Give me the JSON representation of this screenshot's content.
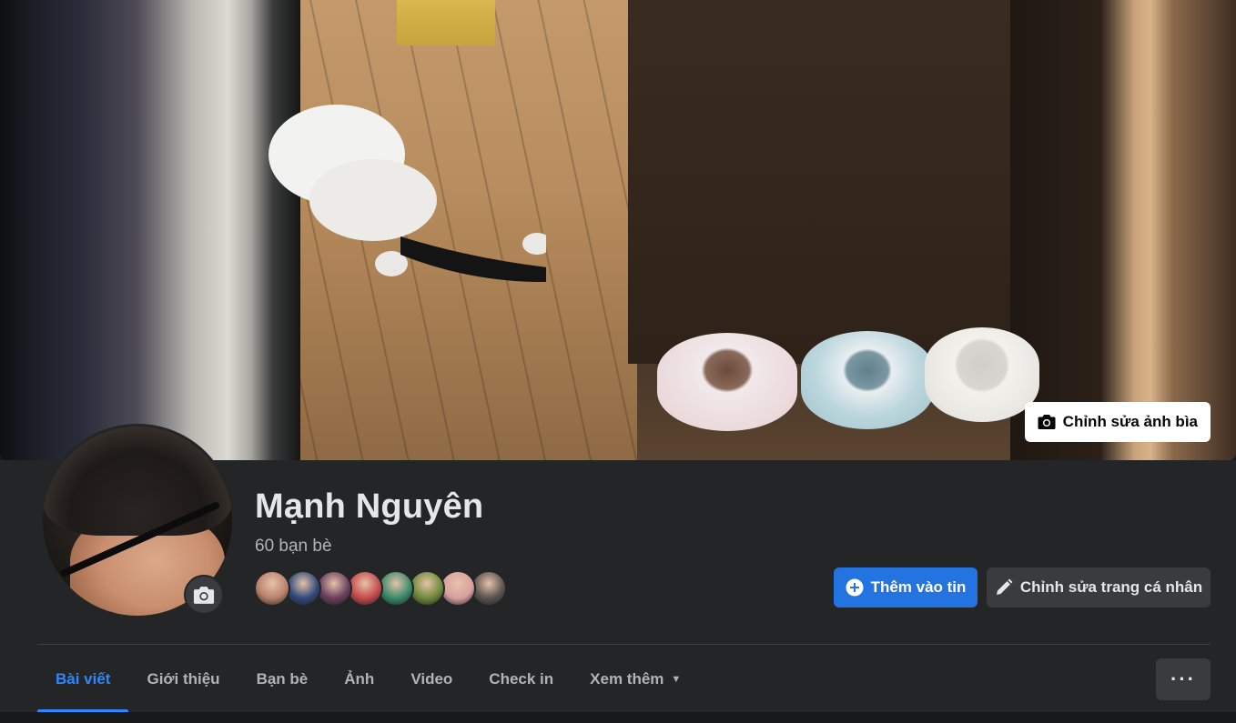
{
  "cover": {
    "edit_button_label": "Chỉnh sửa ảnh bìa",
    "edit_icon": "camera-icon"
  },
  "profile": {
    "name": "Mạnh Nguyên",
    "friend_count": "60 bạn bè",
    "avatar_edit_icon": "camera-icon",
    "friend_avatar_colors": [
      "#b9826a",
      "#2f4a7a",
      "#6a3f5e",
      "#c44a4a",
      "#3a8a6a",
      "#6d8a3a",
      "#d8a0a0",
      "#5a5350"
    ]
  },
  "actions": {
    "add_story_label": "Thêm vào tin",
    "add_story_icon": "plus-circle-icon",
    "edit_profile_label": "Chỉnh sửa trang cá nhân",
    "edit_profile_icon": "pencil-icon",
    "more_label": "···"
  },
  "tabs": [
    {
      "label": "Bài viết",
      "active": true
    },
    {
      "label": "Giới thiệu",
      "active": false
    },
    {
      "label": "Bạn bè",
      "active": false
    },
    {
      "label": "Ảnh",
      "active": false
    },
    {
      "label": "Video",
      "active": false
    },
    {
      "label": "Check in",
      "active": false
    },
    {
      "label": "Xem thêm",
      "active": false,
      "dropdown": true
    }
  ],
  "colors": {
    "accent": "#2d88ff",
    "primary_button": "#2374e1",
    "background": "#242526",
    "secondary_button": "#3a3b3c"
  }
}
